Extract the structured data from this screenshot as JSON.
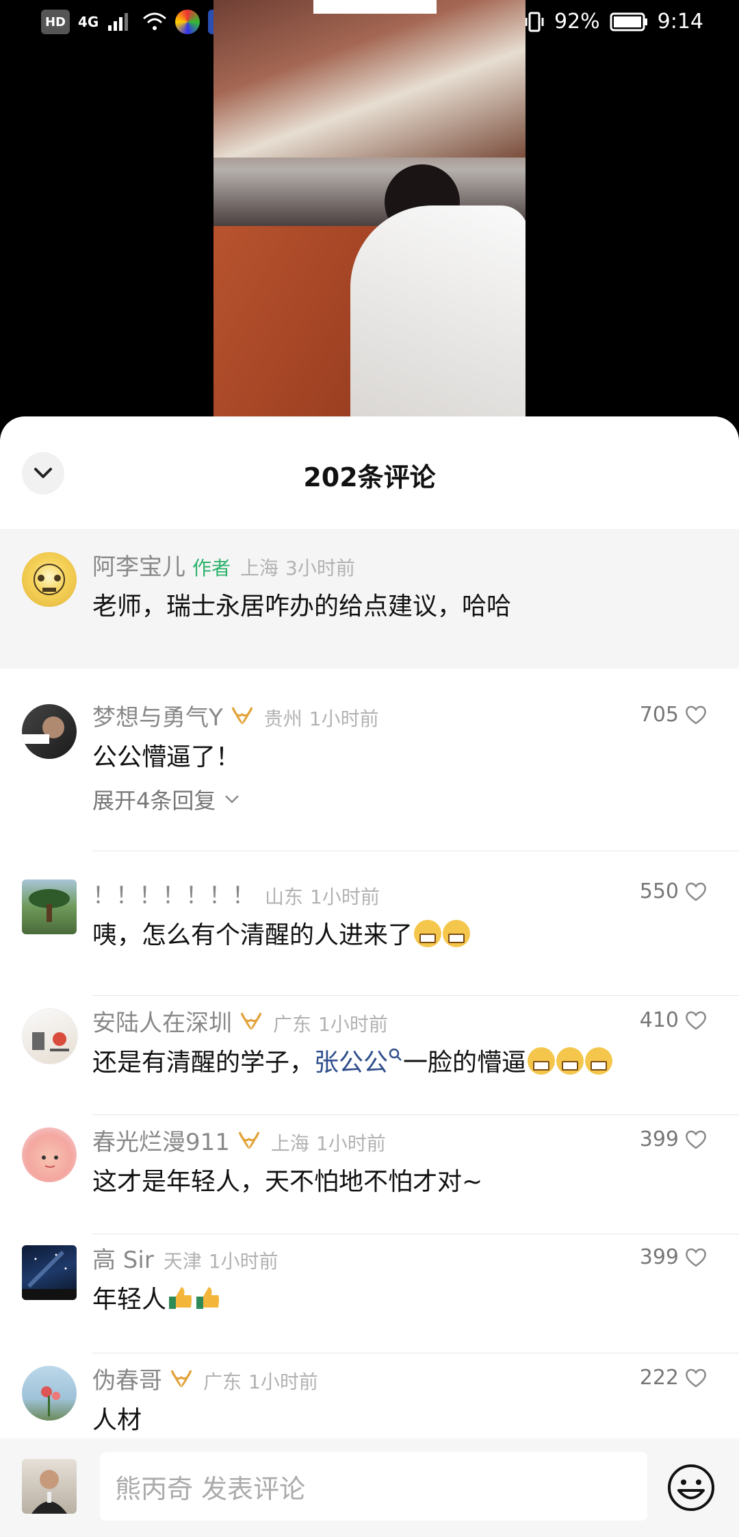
{
  "status_bar": {
    "left_labels": [
      "HD",
      "4G"
    ],
    "battery": "92%",
    "time": "9:14"
  },
  "sheet": {
    "title": "202条评论"
  },
  "pinned_comment": {
    "name": "阿李宝儿",
    "badge": "作者",
    "location": "上海",
    "time": "3小时前",
    "text": "老师，瑞士永居咋办的给点建议，哈哈"
  },
  "comments": [
    {
      "name": "梦想与勇气Y",
      "location": "贵州",
      "time": "1小时前",
      "likes": "705",
      "text": "公公懵逼了！",
      "expand": "展开4条回复"
    },
    {
      "name": "！！！！！！！",
      "location": "山东",
      "time": "1小时前",
      "likes": "550",
      "text": "咦，怎么有个清醒的人进来了"
    },
    {
      "name": "安陆人在深圳",
      "location": "广东",
      "time": "1小时前",
      "likes": "410",
      "text_prefix": "还是有清醒的学子，",
      "text_link": "张公公",
      "text_suffix": "一脸的懵逼"
    },
    {
      "name": "春光烂漫911",
      "location": "上海",
      "time": "1小时前",
      "likes": "399",
      "text": "这才是年轻人，天不怕地不怕才对~"
    },
    {
      "name": "高 Sir",
      "location": "天津",
      "time": "1小时前",
      "likes": "399",
      "text": "年轻人"
    },
    {
      "name": "伪春哥",
      "location": "广东",
      "time": "1小时前",
      "likes": "222",
      "text": "人材"
    }
  ],
  "input": {
    "placeholder": "熊丙奇 发表评论"
  },
  "icons": {
    "collapse": "chevron-down-icon",
    "like": "heart-outline-icon",
    "emoji": "smiley-icon",
    "search": "search-icon"
  },
  "colors": {
    "author_badge": "#2bb36a",
    "vip": "#e2a33a",
    "link": "#2f4e8c"
  }
}
